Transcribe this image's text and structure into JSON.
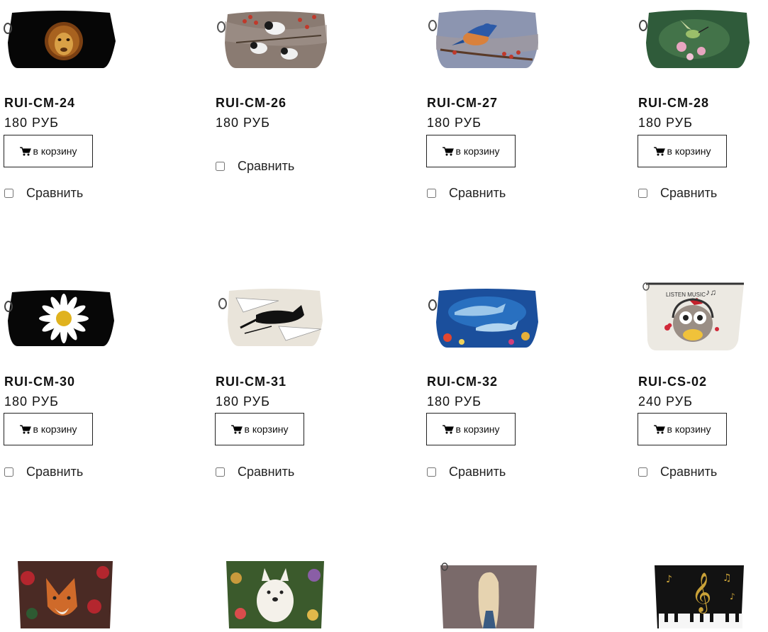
{
  "products": [
    {
      "sku": "RUI-CM-24",
      "price": "180 РУБ",
      "cart_label": "в корзину",
      "compare_label": "Сравнить",
      "image": "lion"
    },
    {
      "sku": "RUI-CM-26",
      "price": "180 РУБ",
      "compare_label": "Сравнить",
      "image": "birds-berries"
    },
    {
      "sku": "RUI-CM-27",
      "price": "180 РУБ",
      "cart_label": "в корзину",
      "compare_label": "Сравнить",
      "image": "bluebird"
    },
    {
      "sku": "RUI-CM-28",
      "price": "180 РУБ",
      "cart_label": "в корзину",
      "compare_label": "Сравнить",
      "image": "hummingbird"
    },
    {
      "sku": "RUI-CM-30",
      "price": "180 РУБ",
      "cart_label": "в корзину",
      "compare_label": "Сравнить",
      "image": "daisy"
    },
    {
      "sku": "RUI-CM-31",
      "price": "180 РУБ",
      "cart_label": "в корзину",
      "compare_label": "Сравнить",
      "image": "black-cat"
    },
    {
      "sku": "RUI-CM-32",
      "price": "180 РУБ",
      "cart_label": "в корзину",
      "compare_label": "Сравнить",
      "image": "dolphins"
    },
    {
      "sku": "RUI-CS-02",
      "price": "240 РУБ",
      "cart_label": "в корзину",
      "compare_label": "Сравнить",
      "image": "owl",
      "image_text": "LISTEN MUSIC"
    },
    {
      "image": "fox"
    },
    {
      "image": "westie"
    },
    {
      "image": "girl"
    },
    {
      "image": "music"
    }
  ]
}
